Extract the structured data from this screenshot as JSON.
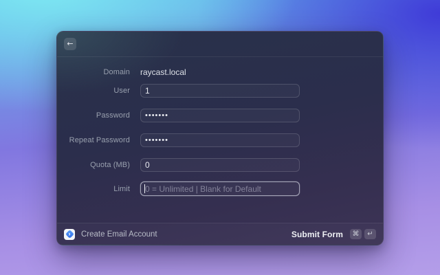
{
  "colors": {
    "background_cyan": "#7ee9f2",
    "background_indigo": "#3f3bd8",
    "background_purple": "#b49ee9",
    "window_top": "#28314a",
    "window_bottom": "#3d3456",
    "app_icon_blue": "#2f6ae8",
    "focus_border": "#ebeef8"
  },
  "window": {
    "header": {
      "back_icon": "←"
    },
    "form": {
      "rows": [
        {
          "label": "Domain",
          "type": "static",
          "value": "raycast.local"
        },
        {
          "label": "User",
          "type": "text",
          "value": "1"
        },
        {
          "label": "Password",
          "type": "password",
          "value": "•••••••"
        },
        {
          "label": "Repeat Password",
          "type": "password",
          "value": "•••••••"
        },
        {
          "label": "Quota (MB)",
          "type": "text",
          "value": "0"
        },
        {
          "label": "Limit",
          "type": "text",
          "value": "",
          "placeholder": "0 = Unlimited | Blank for Default",
          "focused": true
        }
      ]
    },
    "footer": {
      "app_icon_glyph": "›",
      "app_name": "Create Email Account",
      "action_label": "Submit Form",
      "shortcut_keys": [
        "⌘",
        "↵"
      ]
    }
  }
}
